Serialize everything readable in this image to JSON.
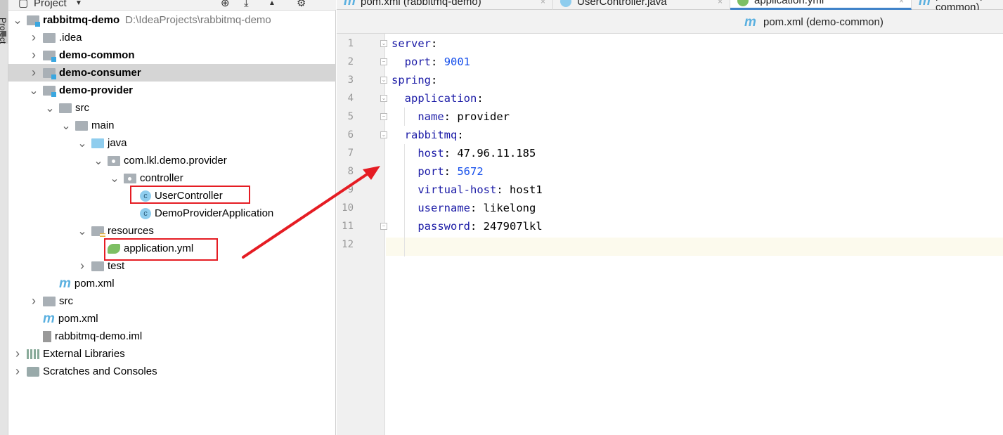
{
  "side_strip": {
    "label": "Project"
  },
  "project_panel": {
    "title": "Project",
    "tree": [
      {
        "label": "rabbitmq-demo",
        "path": "D:\\IdeaProjects\\rabbitmq-demo",
        "icon": "module-folder-icon",
        "expanded": true
      },
      {
        "label": ".idea",
        "icon": "folder-icon",
        "expanded": false
      },
      {
        "label": "demo-common",
        "icon": "module-folder-icon",
        "expanded": false
      },
      {
        "label": "demo-consumer",
        "icon": "module-folder-icon",
        "expanded": false,
        "selected": true
      },
      {
        "label": "demo-provider",
        "icon": "module-folder-icon",
        "expanded": true
      },
      {
        "label": "src",
        "icon": "folder-icon",
        "expanded": true
      },
      {
        "label": "main",
        "icon": "folder-icon",
        "expanded": true
      },
      {
        "label": "java",
        "icon": "source-folder-icon",
        "expanded": true
      },
      {
        "label": "com.lkl.demo.provider",
        "icon": "package-icon",
        "expanded": true
      },
      {
        "label": "controller",
        "icon": "package-icon",
        "expanded": true
      },
      {
        "label": "UserController",
        "icon": "class-icon",
        "highlighted": true
      },
      {
        "label": "DemoProviderApplication",
        "icon": "spring-boot-class-icon"
      },
      {
        "label": "resources",
        "icon": "resources-folder-icon",
        "expanded": true
      },
      {
        "label": "application.yml",
        "icon": "spring-yml-icon",
        "highlighted": true
      },
      {
        "label": "test",
        "icon": "folder-icon",
        "expanded": false
      },
      {
        "label": "pom.xml",
        "icon": "maven-icon"
      },
      {
        "label": "src",
        "icon": "folder-icon",
        "expanded": false
      },
      {
        "label": "pom.xml",
        "icon": "maven-icon"
      },
      {
        "label": "rabbitmq-demo.iml",
        "icon": "iml-file-icon"
      },
      {
        "label": "External Libraries",
        "icon": "libraries-icon",
        "expanded": false
      },
      {
        "label": "Scratches and Consoles",
        "icon": "scratches-icon",
        "expanded": false
      }
    ]
  },
  "tabs": [
    {
      "label": "pom.xml (rabbitmq-demo)",
      "icon": "maven-icon"
    },
    {
      "label": "UserController.java",
      "icon": "class-icon"
    },
    {
      "label": "application.yml",
      "icon": "spring-yml-icon",
      "active": true
    },
    {
      "label": "pom.xml (demo-common)",
      "icon": "maven-icon"
    }
  ],
  "breadcrumb": {
    "label": "pom.xml (demo-common)",
    "icon": "maven-icon"
  },
  "editor": {
    "lines": [
      {
        "n": "1",
        "key": "server",
        "val": ""
      },
      {
        "n": "2",
        "key": "port",
        "val": "9001",
        "num": true
      },
      {
        "n": "3",
        "key": "spring",
        "val": ""
      },
      {
        "n": "4",
        "key": "application",
        "val": ""
      },
      {
        "n": "5",
        "key": "name",
        "val": "provider"
      },
      {
        "n": "6",
        "key": "rabbitmq",
        "val": ""
      },
      {
        "n": "7",
        "key": "host",
        "val": "47.96.11.185"
      },
      {
        "n": "8",
        "key": "port",
        "val": "5672",
        "num": true
      },
      {
        "n": "9",
        "key": "virtual-host",
        "val": "host1"
      },
      {
        "n": "10",
        "key": "username",
        "val": "likelong"
      },
      {
        "n": "11",
        "key": "password",
        "val": "247907lkl"
      },
      {
        "n": "12",
        "key": "",
        "val": ""
      }
    ]
  },
  "colors": {
    "annotation": "#e51c23",
    "key": "#1a1aa6",
    "number": "#1750eb",
    "active_tab": "#4083c9"
  }
}
